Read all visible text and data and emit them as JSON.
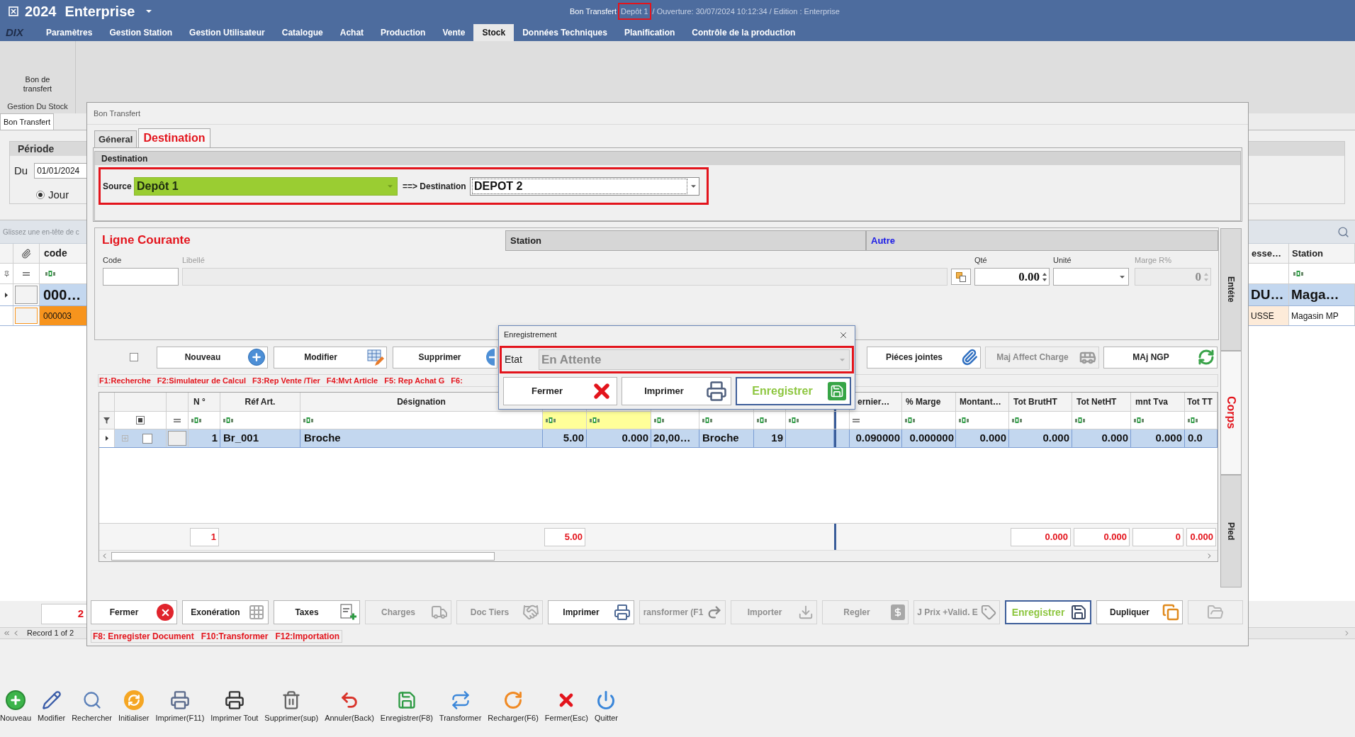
{
  "app": {
    "year": "2024",
    "name": "Enterprise"
  },
  "title_info": {
    "document": "Bon Transfert",
    "depot": "Depôt 1",
    "depot_highlighted": true,
    "details": "/ Ouverture: 30/07/2024 10:12:34 / Edition : Enterprise"
  },
  "logo": "DIX",
  "menu": [
    {
      "label": "Paramètres",
      "selected": false
    },
    {
      "label": "Gestion Station",
      "selected": false
    },
    {
      "label": "Gestion Utilisateur",
      "selected": false
    },
    {
      "label": "Catalogue",
      "selected": false
    },
    {
      "label": "Achat",
      "selected": false
    },
    {
      "label": "Production",
      "selected": false
    },
    {
      "label": "Vente",
      "selected": false
    },
    {
      "label": "Stock",
      "selected": true
    },
    {
      "label": "Données Techniques",
      "selected": false
    },
    {
      "label": "Planification",
      "selected": false
    },
    {
      "label": "Contrôle de la production",
      "selected": false
    }
  ],
  "ribbon": {
    "button": "Bon de transfert",
    "group": "Gestion Du Stock"
  },
  "document_tabs": [
    {
      "label": "Bon Transfert",
      "selected": true
    }
  ],
  "list_form": {
    "period": {
      "title": "Période",
      "from_label": "Du",
      "from_value": "01/01/2024",
      "option": {
        "label": "Jour",
        "selected": true
      }
    },
    "left_grid": {
      "group_hint": "Glissez une en-tête de c",
      "column": "code",
      "rows": [
        {
          "value": "000…",
          "selected": true,
          "highlighted": false
        },
        {
          "value": "000003",
          "selected": false,
          "highlighted": true
        }
      ]
    },
    "right_grid": {
      "columns": [
        "esse…",
        "Station"
      ],
      "rows": [
        {
          "cells": [
            "DU…",
            "Maga…"
          ],
          "selected": true,
          "highlighted": false
        },
        {
          "cells": [
            "USSE",
            "Magasin MP"
          ],
          "selected": false,
          "highlighted": true
        }
      ]
    },
    "count": "2",
    "navigator": "Record 1 of 2"
  },
  "window": {
    "title": "Bon Transfert",
    "tabs": [
      {
        "label": "Géneral",
        "selected": false
      },
      {
        "label": "Destination",
        "selected": true
      }
    ],
    "destination": {
      "title": "Destination",
      "highlighted": true,
      "source_label": "Source",
      "source_value": "Depôt 1",
      "link_label": "==> Destination",
      "destination_value": "DEPOT 2"
    },
    "current_line": {
      "title": "Ligne Courante",
      "sections": [
        {
          "label": "Station",
          "selected": false
        },
        {
          "label": "Autre",
          "selected": true
        }
      ],
      "fields": [
        {
          "kind": "text",
          "label": "Code",
          "disabled": false
        },
        {
          "kind": "text",
          "label": "Libellé",
          "disabled": true
        },
        {
          "kind": "button",
          "disabled": false
        },
        {
          "kind": "spin",
          "label": "Qté",
          "value": "0.00",
          "disabled": false
        },
        {
          "kind": "combo",
          "label": "Unité",
          "disabled": false
        },
        {
          "kind": "spin",
          "label": "Marge R%",
          "value": "0",
          "disabled": true
        }
      ]
    },
    "side_tabs": [
      {
        "label": "Entéte",
        "selected": false
      },
      {
        "label": "Corps",
        "selected": true
      },
      {
        "label": "Pied",
        "selected": false
      }
    ],
    "select_all": {
      "checked": false
    },
    "actions": [
      {
        "label": "Nouveau",
        "disabled": false
      },
      {
        "label": "Modifier",
        "disabled": false
      },
      {
        "label": "Supprimer",
        "disabled": false
      }
    ],
    "actions_right": [
      {
        "label": "Piéces jointes",
        "disabled": false
      },
      {
        "label": "Maj Affect Charge",
        "disabled": true
      },
      {
        "label": "MAj NGP",
        "disabled": false
      }
    ],
    "shortcuts": [
      "F1:Recherche",
      "F2:Simulateur de Calcul",
      "F3:Rep Vente /Tier",
      "F4:Mvt Article",
      "F5: Rep Achat G",
      "F6:"
    ],
    "grid": {
      "filter_select_indeterminate": true,
      "columns": [
        {
          "label": "N °",
          "filter_highlighted": false
        },
        {
          "label": "Réf Art.",
          "filter_highlighted": false
        },
        {
          "label": "Désignation",
          "filter_highlighted": false
        },
        {
          "filter_highlighted": true
        },
        {
          "filter_highlighted": true
        },
        {
          "filter_highlighted": false
        },
        {
          "filter_highlighted": false
        },
        {
          "filter_highlighted": false
        },
        {
          "label": "ernier…",
          "filter_highlighted": false
        },
        {
          "label": "% Marge",
          "filter_highlighted": false
        },
        {
          "label": "Montant…",
          "filter_highlighted": false
        },
        {
          "label": "Tot BrutHT",
          "filter_highlighted": false
        },
        {
          "label": "Tot NetHT",
          "filter_highlighted": false
        },
        {
          "label": "mnt Tva",
          "filter_highlighted": false
        },
        {
          "label": "Tot TT",
          "filter_highlighted": false
        }
      ],
      "rows": [
        {
          "selected": true,
          "checked": false,
          "cells": [
            "1",
            "Br_001",
            "Broche",
            "5.00",
            "0.000",
            "20,00…",
            "Broche",
            "19",
            "0.090000",
            "0.000000",
            "0.000",
            "0.000",
            "0.000",
            "0.000",
            "0.0"
          ]
        }
      ],
      "totals": {
        "column_1": "1",
        "column_4": "5.00",
        "column_12": "0.000",
        "column_13": "0.000",
        "column_14": "0",
        "column_15": "0.000"
      }
    },
    "footer_buttons": [
      {
        "label": "Fermer",
        "disabled": false,
        "focused": false
      },
      {
        "label": "Exonération",
        "disabled": false,
        "focused": false
      },
      {
        "label": "Taxes",
        "disabled": false,
        "focused": false
      },
      {
        "label": "Charges",
        "disabled": true,
        "focused": false
      },
      {
        "label": "Doc Tiers",
        "disabled": true,
        "focused": false
      },
      {
        "label": "Imprimer",
        "disabled": false,
        "focused": false
      },
      {
        "label": "ransformer (F1",
        "disabled": true,
        "focused": false
      },
      {
        "label": "Importer",
        "disabled": true,
        "focused": false
      },
      {
        "label": "Regler",
        "disabled": true,
        "focused": false
      },
      {
        "label": "J Prix +Valid. E",
        "disabled": true,
        "focused": false
      },
      {
        "label": "Enregistrer",
        "disabled": false,
        "focused": true
      },
      {
        "label": "Dupliquer",
        "disabled": false,
        "focused": false
      },
      {
        "disabled": true,
        "focused": false
      }
    ],
    "footer_shortcuts": [
      "F8: Enregister Document",
      "F10:Transformer",
      "F12:Importation"
    ]
  },
  "dialog": {
    "title": "Enregistrement",
    "highlighted": true,
    "state_label": "Etat",
    "state_value": "En Attente",
    "buttons": [
      {
        "label": "Fermer",
        "focused": false
      },
      {
        "label": "Imprimer",
        "focused": false
      },
      {
        "label": "Enregistrer",
        "focused": true
      }
    ]
  },
  "toolbar": [
    "Nouveau",
    "Modifier",
    "Rechercher",
    "Initialiser",
    "Imprimer(F11)",
    "Imprimer Tout",
    "Supprimer(sup)",
    "Annuler(Back)",
    "Enregistrer(F8)",
    "Transformer",
    "Recharger(F6)",
    "Fermer(Esc)",
    "Quitter"
  ]
}
